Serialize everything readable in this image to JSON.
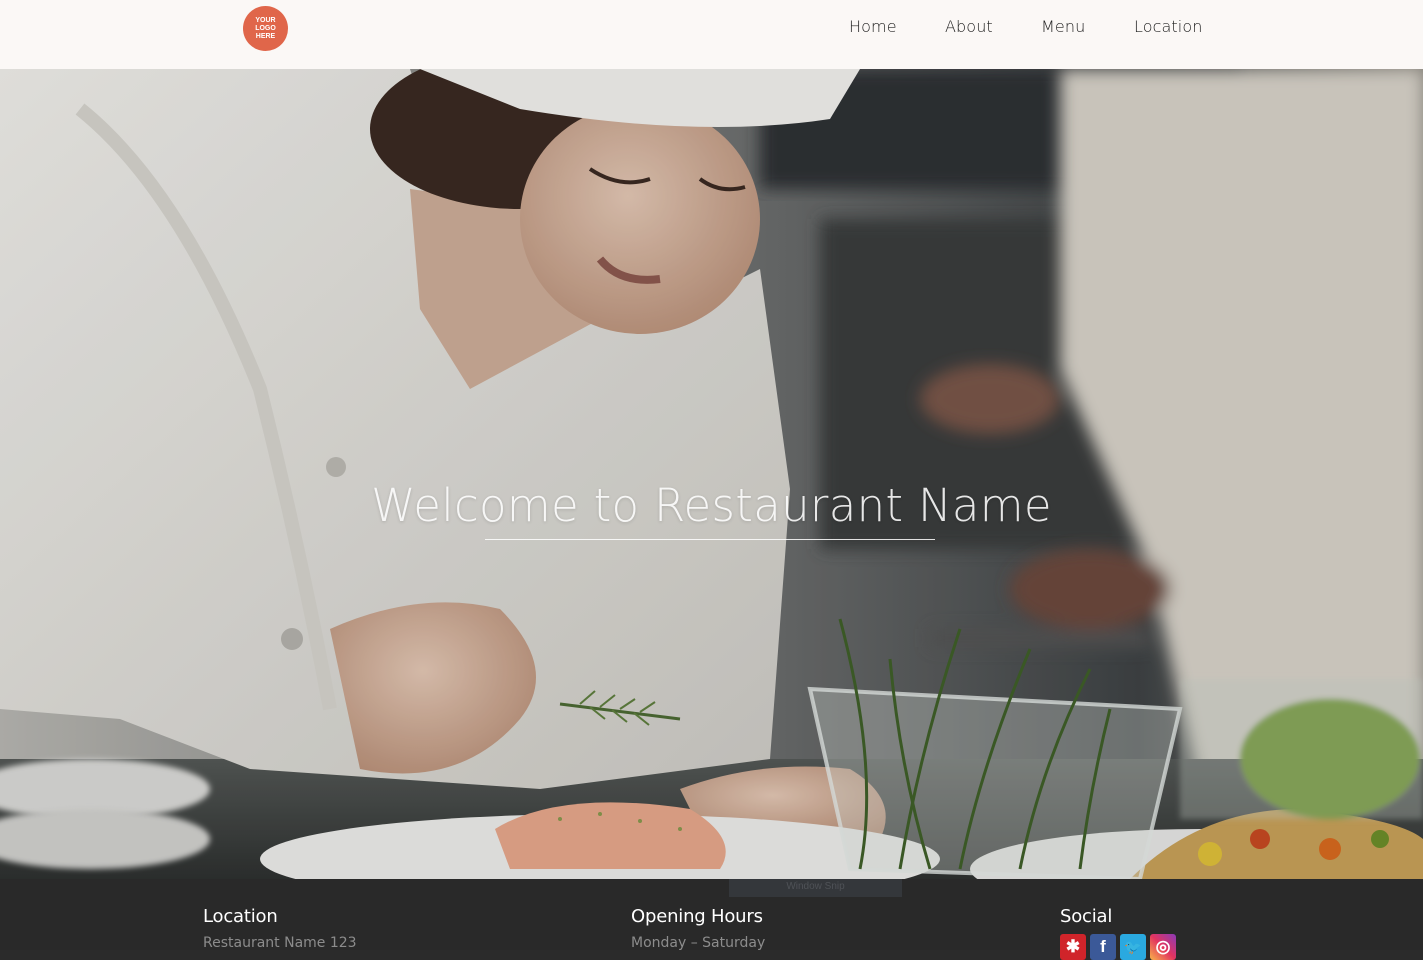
{
  "header": {
    "logo_text": "YOUR\nLOGO\nHERE",
    "nav": [
      "Home",
      "About",
      "Menu",
      "Location"
    ]
  },
  "hero": {
    "title": "Welcome to Restaurant Name",
    "image": "chef-plating-dish-photo"
  },
  "snip_tab": "Window Snip",
  "footer": {
    "location": {
      "heading": "Location",
      "line": "Restaurant Name 123"
    },
    "hours": {
      "heading": "Opening Hours",
      "line": "Monday – Saturday"
    },
    "social": {
      "heading": "Social",
      "icons": [
        "yelp-icon",
        "facebook-icon",
        "twitter-icon",
        "instagram-icon"
      ]
    }
  },
  "colors": {
    "logo": "#e0664a",
    "header_bg": "#fbf8f6",
    "footer_bg": "#292929"
  }
}
